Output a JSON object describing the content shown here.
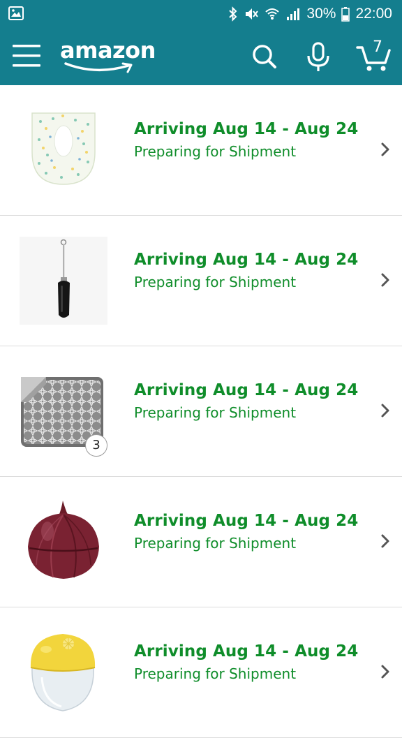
{
  "status_bar": {
    "battery": "30%",
    "time": "22:00"
  },
  "app_bar": {
    "logo": "amazon",
    "cart_count": "7"
  },
  "orders": [
    {
      "arrival": "Arriving Aug 14 - Aug 24",
      "status": "Preparing for Shipment",
      "item_icon": "toilet-seat-cover-icon"
    },
    {
      "arrival": "Arriving Aug 14 - Aug 24",
      "status": "Preparing for Shipment",
      "item_icon": "milk-frother-icon"
    },
    {
      "arrival": "Arriving Aug 14 - Aug 24",
      "status": "Preparing for Shipment",
      "item_icon": "dish-drying-mat-icon",
      "quantity": "3"
    },
    {
      "arrival": "Arriving Aug 14 - Aug 24",
      "status": "Preparing for Shipment",
      "item_icon": "onion-keeper-icon"
    },
    {
      "arrival": "Arriving Aug 14 - Aug 24",
      "status": "Preparing for Shipment",
      "item_icon": "lemon-saver-icon"
    }
  ],
  "colors": {
    "header": "#147e8e",
    "arrival_green": "#0f8d2a"
  }
}
